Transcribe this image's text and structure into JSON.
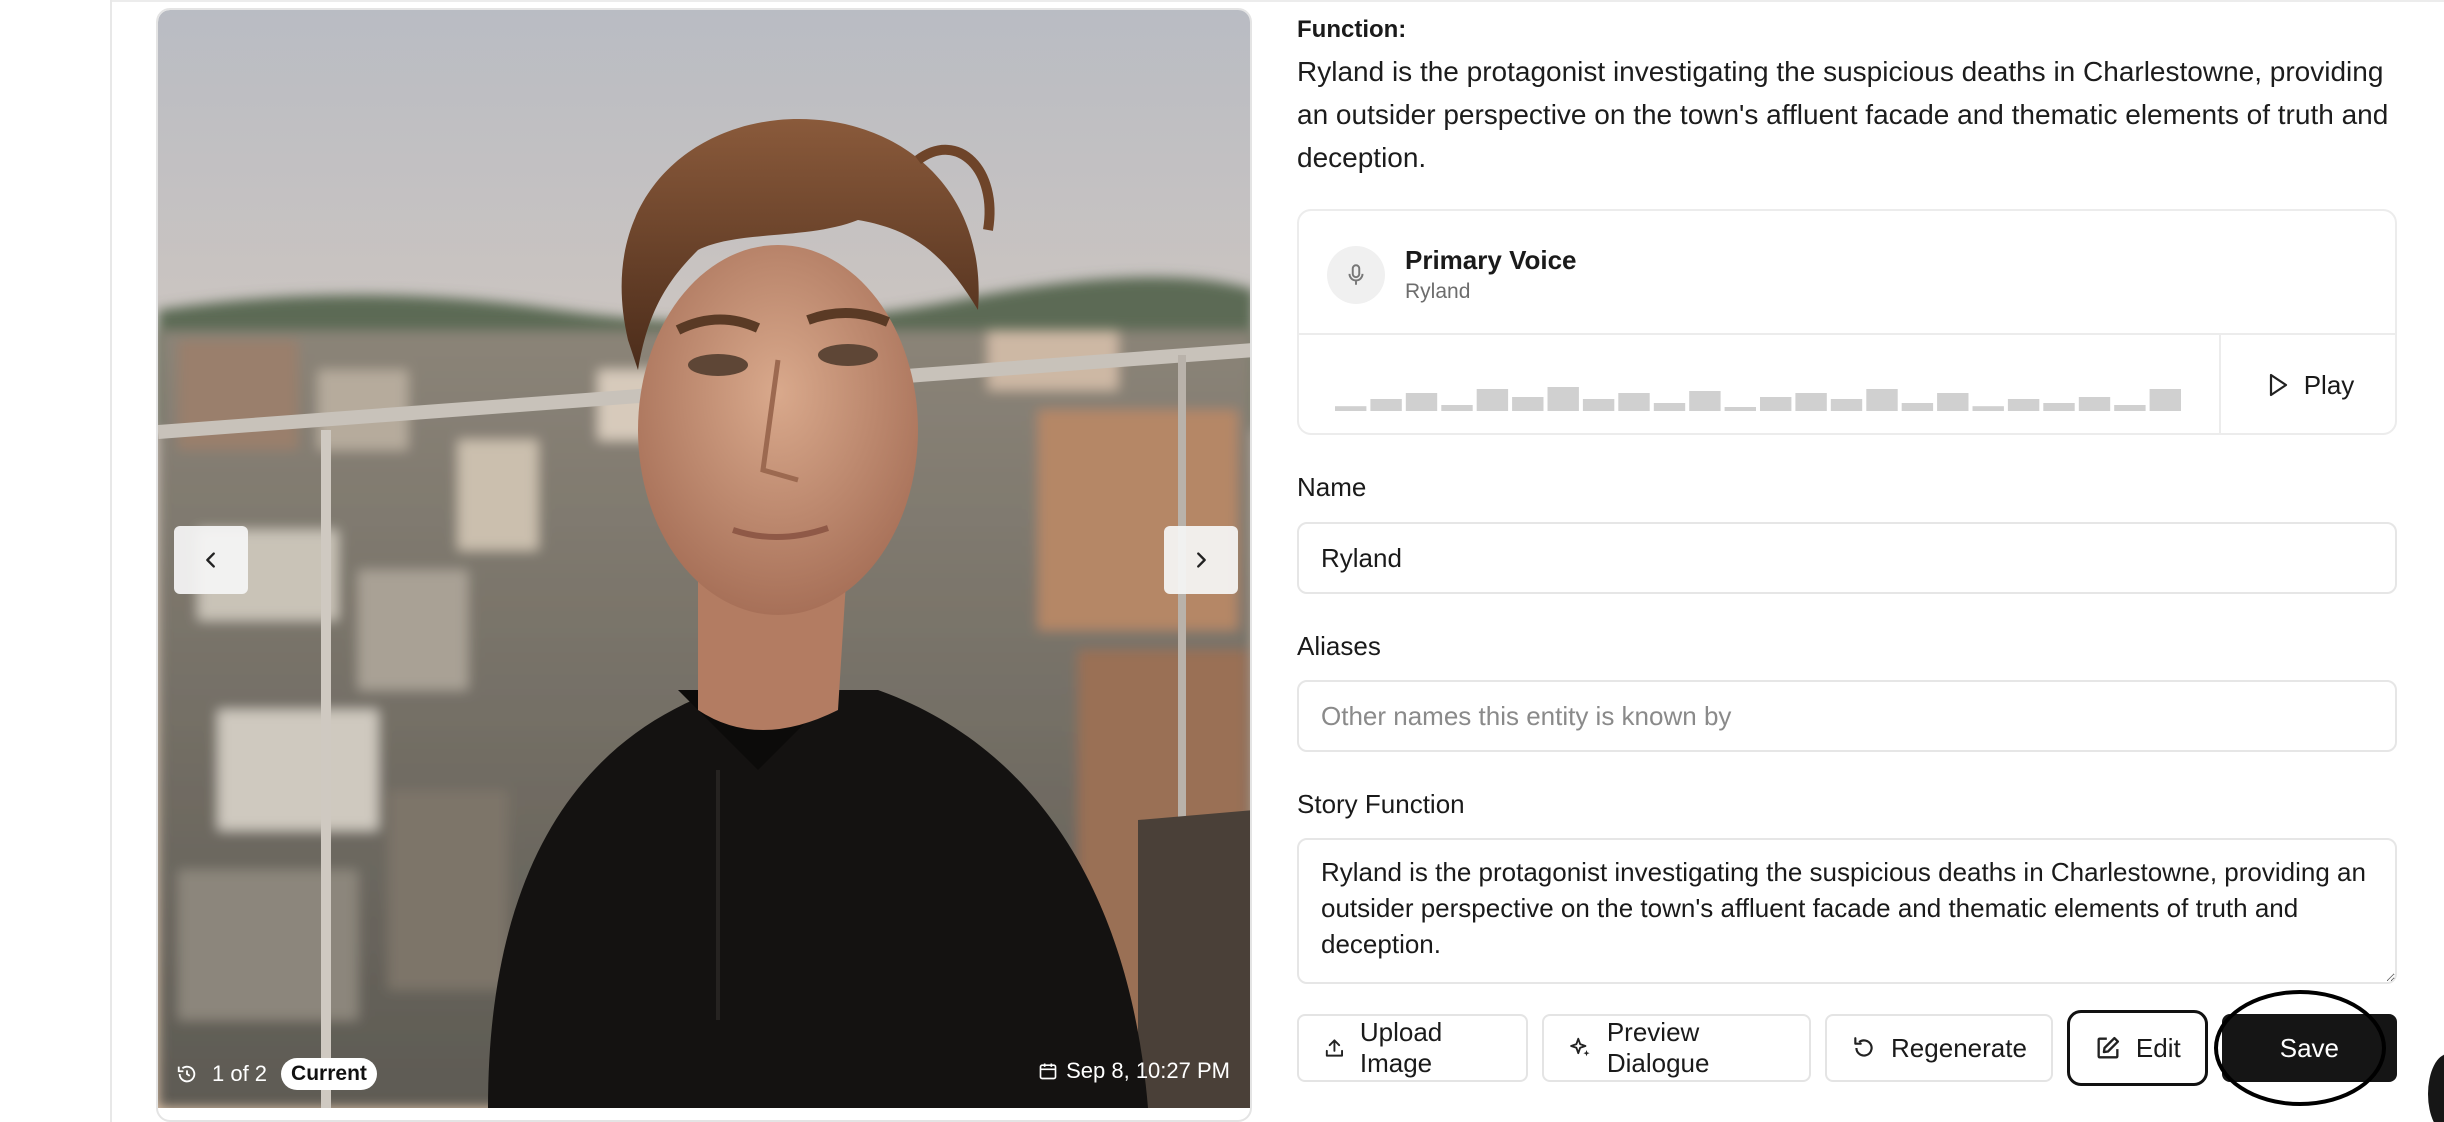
{
  "image_viewer": {
    "version_label": "1 of 2",
    "current_badge": "Current",
    "timestamp": "Sep 8, 10:27 PM",
    "icons": {
      "history": "history-icon",
      "calendar": "calendar-icon",
      "prev": "chevron-left-icon",
      "next": "chevron-right-icon"
    }
  },
  "function_section": {
    "label": "Function:",
    "text": "Ryland is the protagonist investigating the suspicious deaths in Charlestowne, providing an outsider perspective on the town's affluent facade and thematic elements of truth and deception."
  },
  "voice": {
    "title": "Primary Voice",
    "name": "Ryland",
    "play_label": "Play",
    "icons": {
      "mic": "mic-icon",
      "play": "play-icon"
    },
    "waveform_levels": [
      0.12,
      0.3,
      0.45,
      0.15,
      0.55,
      0.35,
      0.6,
      0.3,
      0.45,
      0.2,
      0.5,
      0.1,
      0.35,
      0.45,
      0.3,
      0.55,
      0.2,
      0.45,
      0.12,
      0.3,
      0.2,
      0.35,
      0.15,
      0.55
    ]
  },
  "fields": {
    "name_label": "Name",
    "name_value": "Ryland",
    "aliases_label": "Aliases",
    "aliases_placeholder": "Other names this entity is known by",
    "aliases_value": "",
    "story_function_label": "Story Function",
    "story_function_value": "Ryland is the protagonist investigating the suspicious deaths in Charlestowne, providing an outsider perspective on the town's affluent facade and thematic elements of truth and deception."
  },
  "actions": {
    "upload_label": "Upload Image",
    "preview_label": "Preview Dialogue",
    "regenerate_label": "Regenerate",
    "edit_label": "Edit",
    "save_label": "Save"
  },
  "colors": {
    "primary_button": "#151515",
    "border": "#e4e4e4",
    "muted_text": "#6d6d6d"
  }
}
